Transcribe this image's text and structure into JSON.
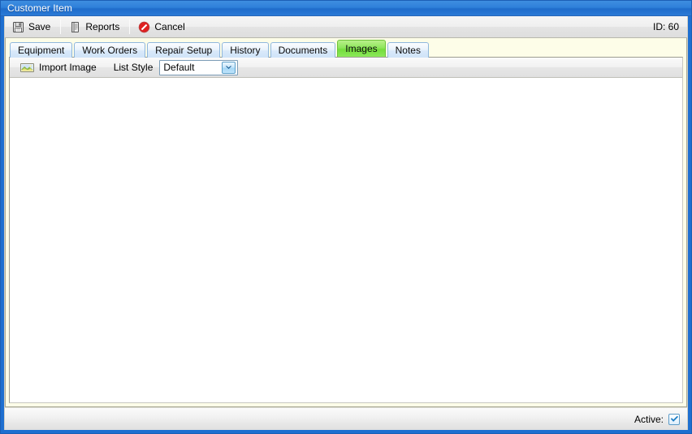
{
  "window": {
    "title": "Customer Item",
    "accent_color": "#2f80da",
    "title_color": "#ffffff"
  },
  "toolbar": {
    "buttons": [
      {
        "label": "Save",
        "icon": "save-floppy-icon"
      },
      {
        "label": "Reports",
        "icon": "report-document-icon"
      },
      {
        "label": "Cancel",
        "icon": "cancel-prohibition-icon"
      }
    ],
    "record_id": "ID: 60"
  },
  "tabs": {
    "items": [
      {
        "label": "Equipment",
        "active": false
      },
      {
        "label": "Work Orders",
        "active": false
      },
      {
        "label": "Repair Setup",
        "active": false
      },
      {
        "label": "History",
        "active": false
      },
      {
        "label": "Documents",
        "active": false
      },
      {
        "label": "Images",
        "active": true
      },
      {
        "label": "Notes",
        "active": false
      }
    ],
    "active_color": "#8ce95a",
    "strip_background": "#fdfde8"
  },
  "images_tab": {
    "import_button": {
      "label": "Import Image",
      "icon": "picture-landscape-icon"
    },
    "list_style": {
      "label": "List Style",
      "value": "Default",
      "options": [
        "Default"
      ]
    },
    "content": ""
  },
  "status": {
    "active_label": "Active:",
    "active_checked": true,
    "check_glyph": "✔"
  }
}
